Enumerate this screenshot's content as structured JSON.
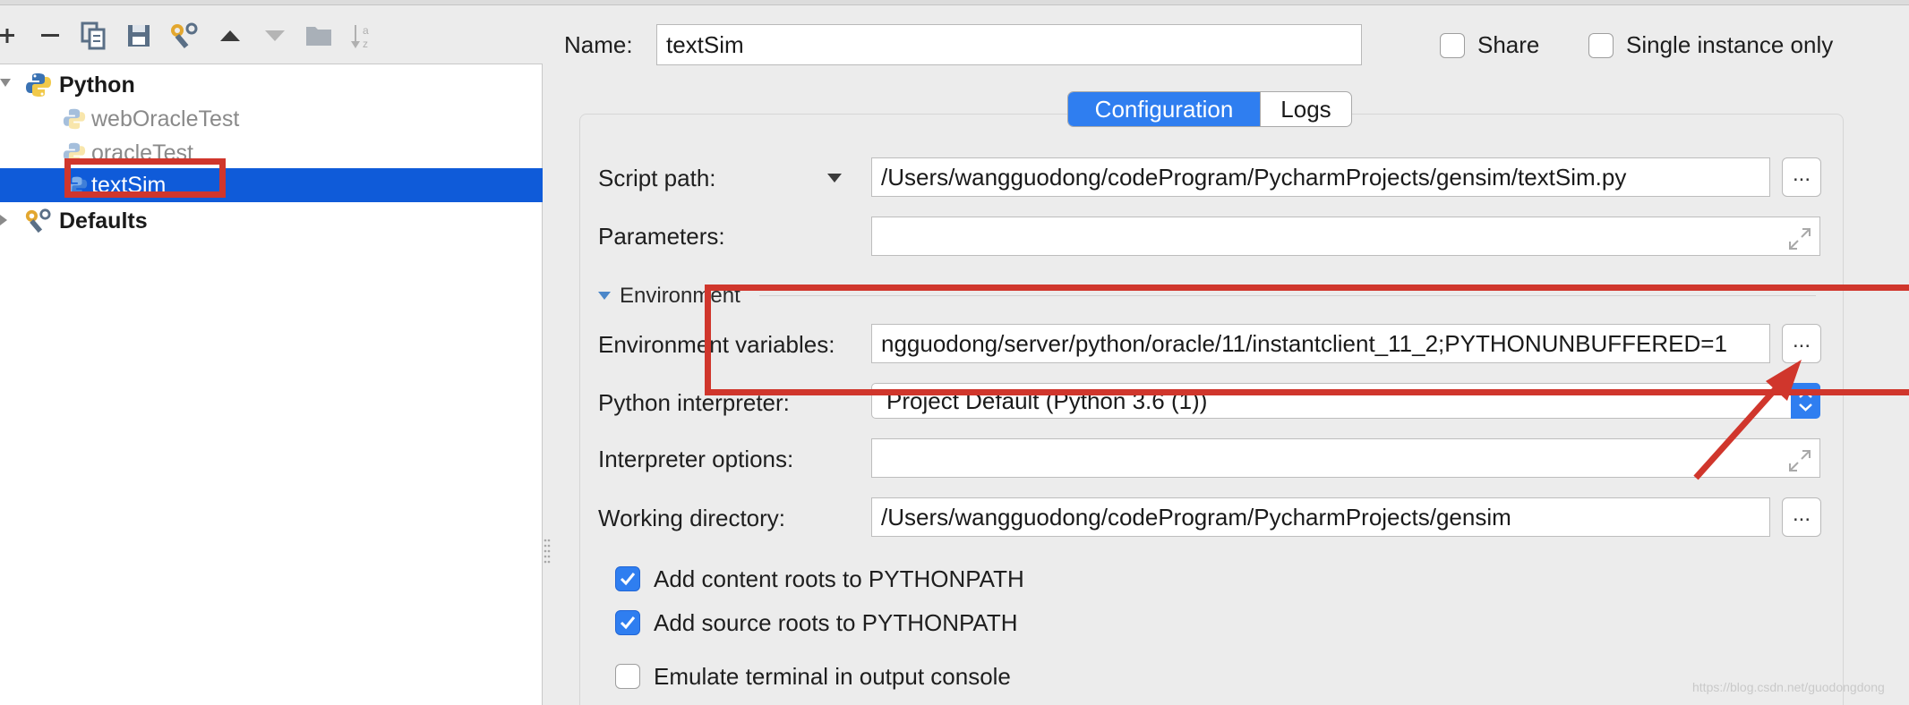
{
  "toolbar": {
    "icons": [
      "add-icon",
      "remove-icon",
      "copy-icon",
      "save-icon",
      "edit-defaults-icon",
      "move-up-icon",
      "move-down-icon",
      "folder-icon",
      "sort-icon"
    ]
  },
  "tree": {
    "python_group": "Python",
    "configs": [
      "webOracleTest",
      "oracleTest",
      "textSim"
    ],
    "selected": "textSim",
    "defaults": "Defaults"
  },
  "header": {
    "name_label": "Name:",
    "name_value": "textSim",
    "share_label": "Share",
    "share_checked": false,
    "single_instance_label": "Single instance only",
    "single_instance_checked": false
  },
  "tabs": {
    "configuration": "Configuration",
    "logs": "Logs",
    "active": "Configuration"
  },
  "form": {
    "script_path_label": "Script path:",
    "script_path_value": "/Users/wangguodong/codeProgram/PycharmProjects/gensim/textSim.py",
    "parameters_label": "Parameters:",
    "parameters_value": "",
    "environment_header": "Environment",
    "env_vars_label": "Environment variables:",
    "env_vars_value": "ngguodong/server/python/oracle/11/instantclient_11_2;PYTHONUNBUFFERED=1",
    "interpreter_label": "Python interpreter:",
    "interpreter_value": "Project Default (Python 3.6 (1))",
    "interpreter_options_label": "Interpreter options:",
    "interpreter_options_value": "",
    "working_dir_label": "Working directory:",
    "working_dir_value": "/Users/wangguodong/codeProgram/PycharmProjects/gensim",
    "browse_label": "...",
    "add_content_roots_label": "Add content roots to PYTHONPATH",
    "add_content_roots_checked": true,
    "add_source_roots_label": "Add source roots to PYTHONPATH",
    "add_source_roots_checked": true,
    "emulate_terminal_label": "Emulate terminal in output console",
    "emulate_terminal_checked": false
  },
  "colors": {
    "selection": "#0f5bd9",
    "accent": "#2f7ef0",
    "annotation": "#d0362c"
  },
  "watermark": "https://blog.csdn.net/guodongdong"
}
